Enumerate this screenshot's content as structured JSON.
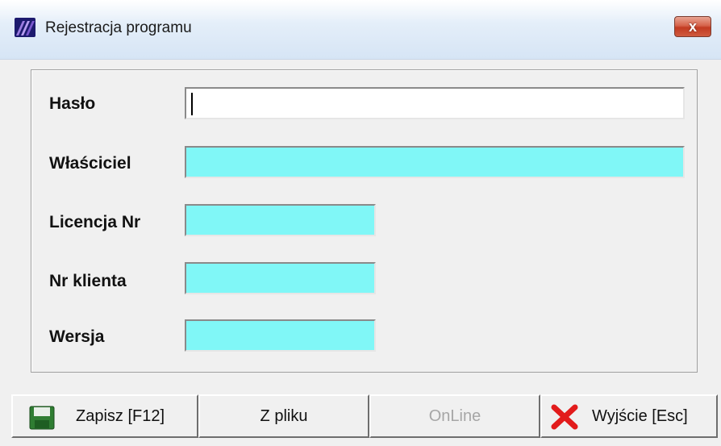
{
  "window": {
    "title": "Rejestracja programu",
    "close_glyph": "x"
  },
  "form": {
    "haslo": {
      "label": "Hasło",
      "value": ""
    },
    "wlasciciel": {
      "label": "Właściciel",
      "value": ""
    },
    "licencja": {
      "label": "Licencja Nr",
      "value": ""
    },
    "nr_klienta": {
      "label": "Nr klienta",
      "value": ""
    },
    "wersja": {
      "label": "Wersja",
      "value": ""
    }
  },
  "buttons": {
    "save": {
      "label": "Zapisz  [F12]",
      "icon": "floppy-disk-icon"
    },
    "from_file": {
      "label": "Z pliku"
    },
    "online": {
      "label": "OnLine",
      "enabled": false
    },
    "exit": {
      "label": "Wyjście  [Esc]",
      "icon": "red-x-icon"
    }
  },
  "colors": {
    "readonly_field": "#80f7f7",
    "close_button": "#c23b22"
  }
}
